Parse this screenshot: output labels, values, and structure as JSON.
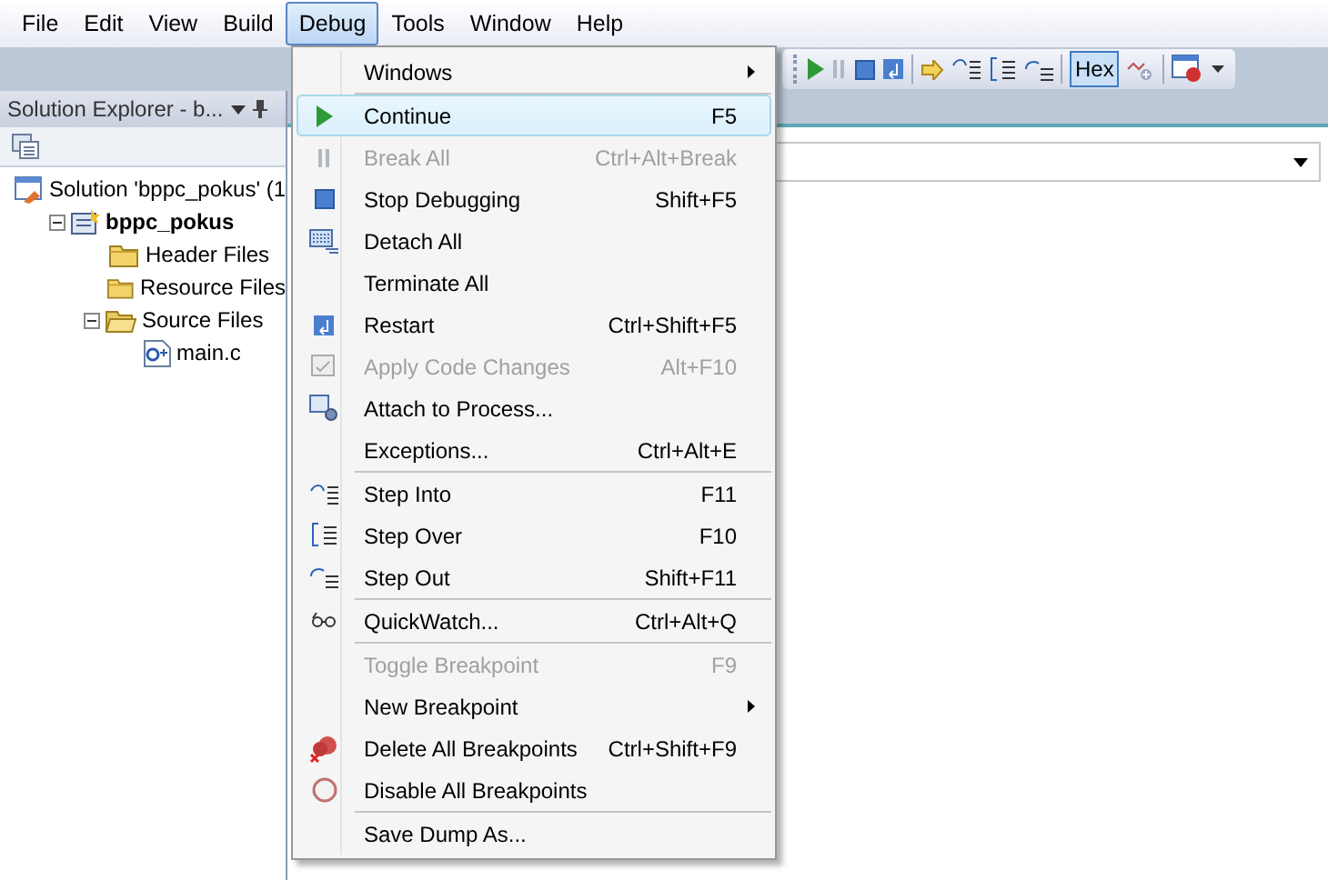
{
  "menubar": [
    {
      "label": "File",
      "selected": false
    },
    {
      "label": "Edit",
      "selected": false
    },
    {
      "label": "View",
      "selected": false
    },
    {
      "label": "Build",
      "selected": false
    },
    {
      "label": "Debug",
      "selected": true
    },
    {
      "label": "Tools",
      "selected": false
    },
    {
      "label": "Window",
      "selected": false
    },
    {
      "label": "Help",
      "selected": false
    }
  ],
  "toolbar": {
    "hex": {
      "label": "Hex",
      "selected": true
    }
  },
  "solution_explorer": {
    "title": "Solution Explorer - b...",
    "tree": [
      {
        "label": "Solution 'bppc_pokus' (1",
        "kind": "solution",
        "children": [
          {
            "label": "bppc_pokus",
            "kind": "project",
            "bold": true,
            "expanded": true,
            "children": [
              {
                "label": "Header Files",
                "kind": "folder"
              },
              {
                "label": "Resource Files",
                "kind": "folder"
              },
              {
                "label": "Source Files",
                "kind": "folder",
                "expanded": true,
                "children": [
                  {
                    "label": "main.c",
                    "kind": "file"
                  }
                ]
              }
            ]
          }
        ]
      }
    ]
  },
  "debug_menu": {
    "groups": [
      [
        {
          "label": "Windows",
          "submenu": true
        }
      ],
      [
        {
          "label": "Continue",
          "shortcut": "F5",
          "selected": true,
          "disabled": false
        },
        {
          "label": "Break All",
          "shortcut": "Ctrl+Alt+Break",
          "selected": false,
          "disabled": true
        },
        {
          "label": "Stop Debugging",
          "shortcut": "Shift+F5",
          "selected": false,
          "disabled": false
        },
        {
          "label": "Detach All",
          "selected": false,
          "disabled": false
        },
        {
          "label": "Terminate All",
          "selected": false,
          "disabled": false
        },
        {
          "label": "Restart",
          "shortcut": "Ctrl+Shift+F5",
          "selected": false,
          "disabled": false
        },
        {
          "label": "Apply Code Changes",
          "shortcut": "Alt+F10",
          "selected": false,
          "disabled": true
        },
        {
          "label": "Attach to Process...",
          "selected": false,
          "disabled": false
        },
        {
          "label": "Exceptions...",
          "shortcut": "Ctrl+Alt+E",
          "selected": false,
          "disabled": false
        }
      ],
      [
        {
          "label": "Step Into",
          "shortcut": "F11",
          "selected": false,
          "disabled": false
        },
        {
          "label": "Step Over",
          "shortcut": "F10",
          "selected": false,
          "disabled": false
        },
        {
          "label": "Step Out",
          "shortcut": "Shift+F11",
          "selected": false,
          "disabled": false
        }
      ],
      [
        {
          "label": "QuickWatch...",
          "shortcut": "Ctrl+Alt+Q",
          "selected": false,
          "disabled": false
        }
      ],
      [
        {
          "label": "Toggle Breakpoint",
          "shortcut": "F9",
          "selected": false,
          "disabled": true
        },
        {
          "label": "New Breakpoint",
          "submenu": true,
          "selected": false,
          "disabled": false
        },
        {
          "label": "Delete All Breakpoints",
          "shortcut": "Ctrl+Shift+F9",
          "selected": false,
          "disabled": false
        },
        {
          "label": "Disable All Breakpoints",
          "selected": false,
          "disabled": false
        }
      ],
      [
        {
          "label": "Save Dump As...",
          "selected": false,
          "disabled": false
        }
      ]
    ]
  }
}
